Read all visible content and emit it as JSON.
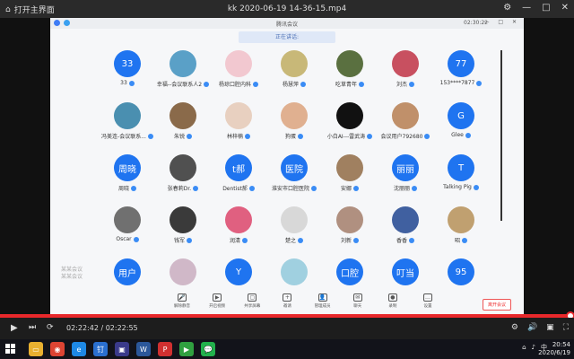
{
  "player": {
    "home_label": "打开主界面",
    "file_name": "kk 2020-06-19 14-36-15.mp4",
    "current_time": "02:22:42",
    "duration": "02:22:55",
    "time_display": "02:22:42 / 02:22:55",
    "progress_fraction": 0.998
  },
  "meeting": {
    "app_name": "腾讯会议",
    "elapsed": "02:30:22",
    "speaking_label": "正在讲话:",
    "end_button": "离开会议",
    "watermark": "某某会议\n某某会议"
  },
  "participants": [
    {
      "av": "33",
      "name": "33",
      "type": "text"
    },
    {
      "av": "",
      "name": "幸福--会议联系人2",
      "type": "img",
      "color": "#5aa0c7"
    },
    {
      "av": "",
      "name": "杨琼口腔内科",
      "type": "img",
      "color": "#f2c8d0"
    },
    {
      "av": "",
      "name": "杨慧萍",
      "type": "img",
      "color": "#c8b878"
    },
    {
      "av": "",
      "name": "吃草青年",
      "type": "img",
      "color": "#5a7040"
    },
    {
      "av": "",
      "name": "刘杰",
      "type": "img",
      "color": "#c85060"
    },
    {
      "av": "77",
      "name": "153****7877",
      "type": "text"
    },
    {
      "av": "",
      "name": "冯美连-会议联系...",
      "type": "img",
      "color": "#4a8fb0"
    },
    {
      "av": "",
      "name": "朱锐",
      "type": "img",
      "color": "#8a6a4a"
    },
    {
      "av": "",
      "name": "林梓楠",
      "type": "img",
      "color": "#e8d0c0"
    },
    {
      "av": "",
      "name": "狗蛋",
      "type": "img",
      "color": "#e0b090"
    },
    {
      "av": "",
      "name": "小白AI---雷武涛",
      "type": "img",
      "color": "#111111"
    },
    {
      "av": "",
      "name": "会议用户792680",
      "type": "img",
      "color": "#c0906a"
    },
    {
      "av": "G",
      "name": "Glee",
      "type": "text"
    },
    {
      "av": "周晓",
      "name": "周晓",
      "type": "text"
    },
    {
      "av": "",
      "name": "张春莉Dr.",
      "type": "img",
      "color": "#505050"
    },
    {
      "av": "t郝",
      "name": "Dentist郝",
      "type": "text"
    },
    {
      "av": "医院",
      "name": "淮安市口腔医院",
      "type": "text"
    },
    {
      "av": "",
      "name": "安娜",
      "type": "img",
      "color": "#a08060"
    },
    {
      "av": "丽丽",
      "name": "沈丽丽",
      "type": "text"
    },
    {
      "av": "T",
      "name": "Talking Pig",
      "type": "text"
    },
    {
      "av": "",
      "name": "Oscar",
      "type": "img",
      "color": "#707070"
    },
    {
      "av": "",
      "name": "钱军",
      "type": "img",
      "color": "#3a3a3a"
    },
    {
      "av": "",
      "name": "润清",
      "type": "img",
      "color": "#e06080"
    },
    {
      "av": "",
      "name": "楚之",
      "type": "img",
      "color": "#d8d8d8"
    },
    {
      "av": "",
      "name": "刘新",
      "type": "img",
      "color": "#b09080"
    },
    {
      "av": "",
      "name": "香香",
      "type": "img",
      "color": "#4060a0"
    },
    {
      "av": "",
      "name": "昭",
      "type": "img",
      "color": "#c0a070"
    },
    {
      "av": "用户",
      "name": "",
      "type": "text"
    },
    {
      "av": "",
      "name": "",
      "type": "img",
      "color": "#d0b8c8"
    },
    {
      "av": "Y",
      "name": "",
      "type": "text"
    },
    {
      "av": "",
      "name": "",
      "type": "img",
      "color": "#a0d0e0"
    },
    {
      "av": "口腔",
      "name": "",
      "type": "text"
    },
    {
      "av": "叮当",
      "name": "",
      "type": "text"
    },
    {
      "av": "95",
      "name": "",
      "type": "text"
    }
  ],
  "toolbar": [
    {
      "icon": "mic-icon",
      "glyph": "🎤",
      "label": "解除静音"
    },
    {
      "icon": "camera-icon",
      "glyph": "▶",
      "label": "开启视频"
    },
    {
      "icon": "share-icon",
      "glyph": "▢",
      "label": "共享屏幕"
    },
    {
      "icon": "invite-icon",
      "glyph": "+",
      "label": "邀请"
    },
    {
      "icon": "members-icon",
      "glyph": "👤",
      "label": "管理成员"
    },
    {
      "icon": "chat-icon",
      "glyph": "✉",
      "label": "聊天"
    },
    {
      "icon": "record-icon",
      "glyph": "●",
      "label": "录制"
    },
    {
      "icon": "more-icon",
      "glyph": "…",
      "label": "设置"
    }
  ],
  "taskbar": {
    "time": "20:54",
    "date": "2020/6/19",
    "ime": "中",
    "apps": [
      {
        "icon": "folder-icon",
        "color": "#e8b030",
        "glyph": "▭"
      },
      {
        "icon": "chrome-icon",
        "color": "#dd4433",
        "glyph": "◉"
      },
      {
        "icon": "edge-icon",
        "color": "#1e88e5",
        "glyph": "e"
      },
      {
        "icon": "app-icon",
        "color": "#2a6fd0",
        "glyph": "钉"
      },
      {
        "icon": "camera-app-icon",
        "color": "#3a3a8a",
        "glyph": "▣"
      },
      {
        "icon": "word-icon",
        "color": "#2b579a",
        "glyph": "W"
      },
      {
        "icon": "pdf-icon",
        "color": "#d03030",
        "glyph": "P"
      },
      {
        "icon": "player-icon",
        "color": "#30a040",
        "glyph": "▶"
      },
      {
        "icon": "wechat-icon",
        "color": "#22b14c",
        "glyph": "💬"
      }
    ]
  }
}
